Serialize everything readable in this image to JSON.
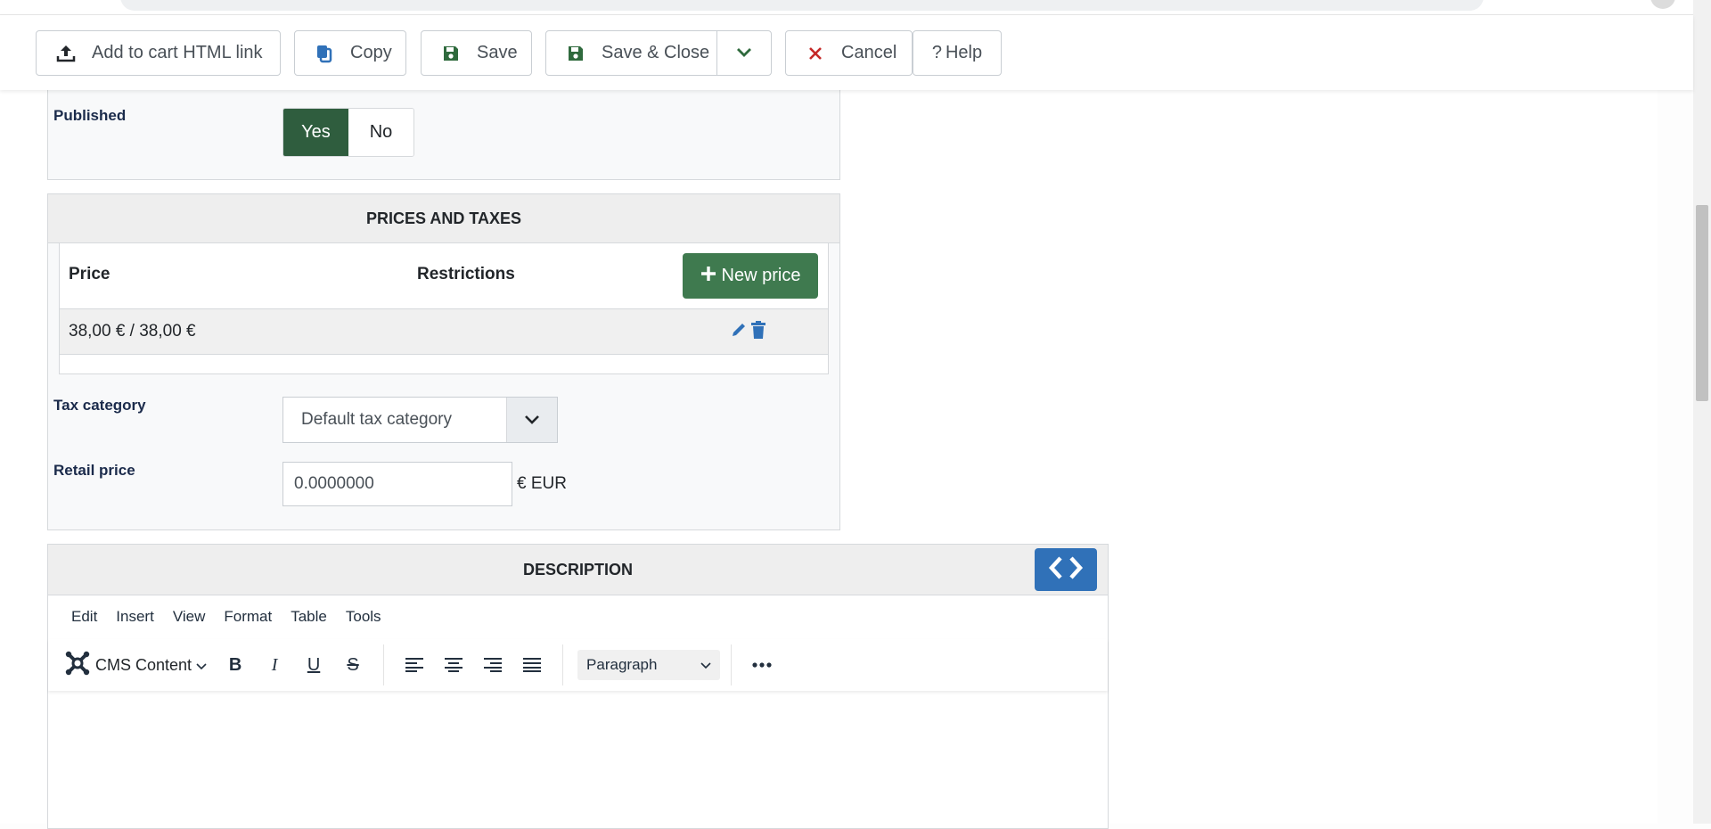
{
  "toolbar": {
    "add_to_cart_label": "Add to cart HTML link",
    "copy_label": "Copy",
    "save_label": "Save",
    "save_close_label": "Save & Close",
    "cancel_label": "Cancel",
    "help_label": "Help"
  },
  "published": {
    "label": "Published",
    "yes": "Yes",
    "no": "No",
    "selected": "Yes"
  },
  "prices": {
    "section_title": "PRICES AND TAXES",
    "col_price": "Price",
    "col_restrictions": "Restrictions",
    "new_price_label": "New price",
    "rows": [
      {
        "price": "38,00 € / 38,00 €"
      }
    ]
  },
  "tax": {
    "label": "Tax category",
    "selected": "Default tax category"
  },
  "retail": {
    "label": "Retail price",
    "value": "0.0000000",
    "unit": "€ EUR"
  },
  "description": {
    "section_title": "DESCRIPTION",
    "menu": [
      "Edit",
      "Insert",
      "View",
      "Format",
      "Table",
      "Tools"
    ],
    "cms_content_label": "CMS Content",
    "block_format": "Paragraph"
  },
  "colors": {
    "accent_green": "#2f5d3e",
    "button_green": "#3f7a4f",
    "accent_blue": "#3071b8",
    "danger_red": "#c52827"
  }
}
